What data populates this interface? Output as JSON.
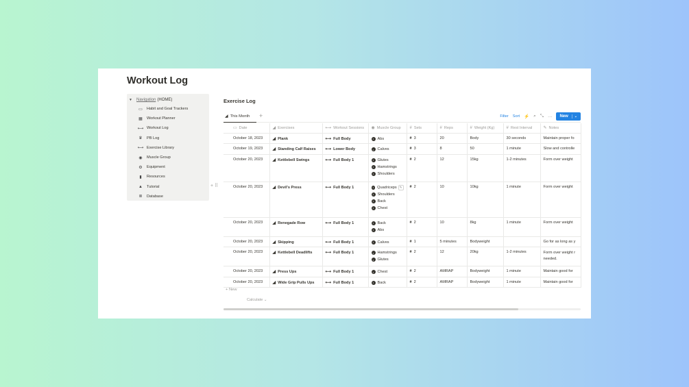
{
  "page": {
    "title": "Workout Log"
  },
  "nav": {
    "head_link": "Navigation",
    "head_suffix": "(HOME)",
    "items": [
      {
        "label": "Habit and Goal Trackers",
        "icon": "monitor-icon"
      },
      {
        "label": "Workout Planner",
        "icon": "calendar-icon"
      },
      {
        "label": "Workout Log",
        "icon": "dumbbell-icon"
      },
      {
        "label": "PB Log",
        "icon": "trophy-icon"
      },
      {
        "label": "Exercise Library",
        "icon": "dumbbell-icon"
      },
      {
        "label": "Muscle Group",
        "icon": "target-icon"
      },
      {
        "label": "Equipment",
        "icon": "gear-icon"
      },
      {
        "label": "Resources",
        "icon": "bookmark-icon"
      },
      {
        "label": "Tutorial",
        "icon": "graduation-cap-icon"
      },
      {
        "label": "Database",
        "icon": "database-icon"
      }
    ]
  },
  "db": {
    "title": "Exercise Log",
    "tab": "This Month",
    "tab_add": "+",
    "filter": "Filter",
    "sort": "Sort",
    "new_button": "New",
    "columns": [
      "Date",
      "Exercises",
      "Workout Sessions",
      "Muscle Group",
      "Sets",
      "Reps",
      "Weight (Kg)",
      "Rest Interval",
      "Notes"
    ],
    "rows": [
      {
        "date": "October 18, 2023",
        "exercise": "Plank",
        "session": "Full Body",
        "muscles": [
          "Abs"
        ],
        "sets": "3",
        "reps": "20",
        "weight": "Body",
        "rest": "30 seconds",
        "notes": "Maintain proper fo"
      },
      {
        "date": "October 19, 2023",
        "exercise": "Standing Calf Raises",
        "session": "Lower Body",
        "muscles": [
          "Calves"
        ],
        "sets": "3",
        "reps": "8",
        "weight": "50",
        "rest": "1 minute",
        "notes": "Slow and controlle"
      },
      {
        "date": "October 20, 2023",
        "exercise": "Kettlebell Swings",
        "session": "Full Body 1",
        "muscles": [
          "Glutes",
          "Hamstrings",
          "Shoulders"
        ],
        "sets": "2",
        "reps": "12",
        "weight": "15kg",
        "rest": "1-2 minutes",
        "notes": "Form over weight"
      },
      {
        "date": "October 20, 2023",
        "exercise": "Devil's Press",
        "session": "Full Body 1",
        "muscles": [
          "Quadriceps",
          "Shoulders",
          "Back",
          "Chest"
        ],
        "sets": "2",
        "reps": "10",
        "weight": "10kg",
        "rest": "1 minute",
        "notes": "Form over weight"
      },
      {
        "date": "October 20, 2023",
        "exercise": "Renegade Row",
        "session": "Full Body 1",
        "muscles": [
          "Back",
          "Abs"
        ],
        "sets": "2",
        "reps": "10",
        "weight": "8kg",
        "rest": "1 minute",
        "notes": "Form over weight"
      },
      {
        "date": "October 20, 2023",
        "exercise": "Skipping",
        "session": "Full Body 1",
        "muscles": [
          "Calves"
        ],
        "sets": "1",
        "reps": "5 minutes",
        "weight": "Bodyweight",
        "rest": "",
        "notes": "Go for as long as y"
      },
      {
        "date": "October 20, 2023",
        "exercise": "Kettlebell Deadlifts",
        "session": "Full Body 1",
        "muscles": [
          "Hamstrings",
          "Glutes"
        ],
        "sets": "2",
        "reps": "12",
        "weight": "20kg",
        "rest": "1-2 minutes",
        "notes": "Form over weight r needed."
      },
      {
        "date": "October 20, 2023",
        "exercise": "Press Ups",
        "session": "Full Body 1",
        "muscles": [
          "Chest"
        ],
        "sets": "2",
        "reps": "AMRAP",
        "weight": "Bodyweight",
        "rest": "1 minute",
        "notes": "Maintain good for"
      },
      {
        "date": "October 20, 2023",
        "exercise": "Wide Grip Pulls Ups",
        "session": "Full Body 1",
        "muscles": [
          "Back"
        ],
        "sets": "2",
        "reps": "AMRAP",
        "weight": "Bodyweight",
        "rest": "1 minute",
        "notes": "Maintain good for"
      }
    ],
    "new_row": "+ New",
    "calculate": "Calculate ⌄"
  }
}
